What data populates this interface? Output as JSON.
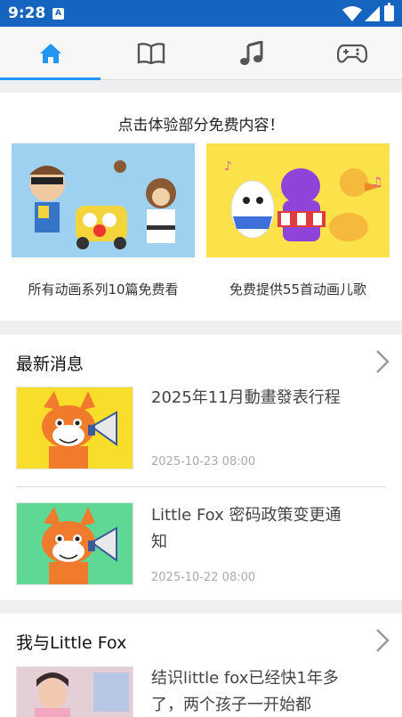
{
  "status_bar": {
    "time": "9:28",
    "sim_badge": "A",
    "wifi": "wifi-icon",
    "signal": "signal-icon",
    "battery": "battery-charging-icon"
  },
  "tabs": [
    {
      "name": "home",
      "icon": "home-icon",
      "active": true
    },
    {
      "name": "books",
      "icon": "book-icon",
      "active": false
    },
    {
      "name": "songs",
      "icon": "music-note-icon",
      "active": false
    },
    {
      "name": "games",
      "icon": "gamepad-icon",
      "active": false
    }
  ],
  "promo": {
    "title": "点击体验部分免费内容！",
    "items": [
      {
        "label": "所有动画系列10篇免费看"
      },
      {
        "label": "免费提供55首动画儿歌"
      }
    ]
  },
  "news": {
    "title": "最新消息",
    "items": [
      {
        "title": "2025年11月動畫發表行程",
        "date": "2025-10-23 08:00"
      },
      {
        "title": "Little Fox 密码政策变更通知",
        "date": "2025-10-22 08:00"
      }
    ]
  },
  "reviews": {
    "title": "我与Little Fox",
    "items": [
      {
        "text": "结识little fox已经快1年多了，两个孩子一开始都"
      }
    ]
  },
  "colors": {
    "accent": "#2196f3",
    "status_bar": "#1565c0",
    "promo_left_bg": "#9ed0f0",
    "promo_right_bg": "#fbe24a",
    "news1_bg": "#f8dd2a",
    "news2_bg": "#5fd895"
  }
}
